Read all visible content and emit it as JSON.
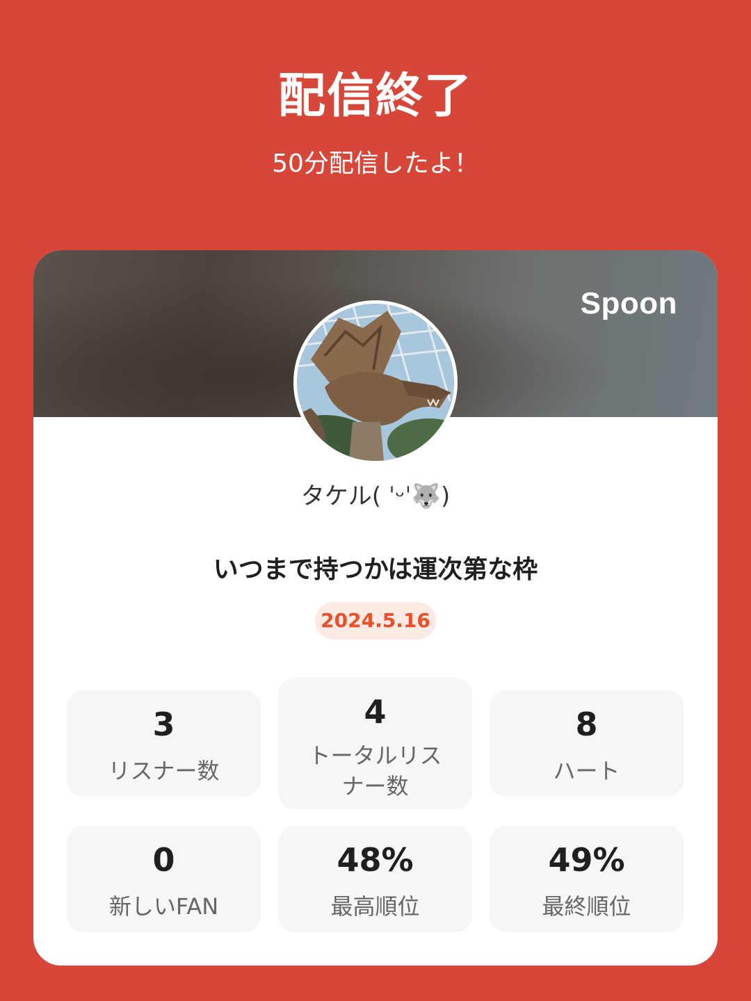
{
  "header": {
    "title": "配信終了",
    "subtitle": "50分配信したよ！"
  },
  "card": {
    "brand": "Spoon",
    "avatar_icon": "dragon-photo-avatar",
    "host_name": "タケル( ˈᵕˈ🐺)",
    "broadcast_title": "いつまで持つかは運次第な枠",
    "date": "2024.5.16"
  },
  "stats": [
    {
      "value": "3",
      "label": "リスナー数"
    },
    {
      "value": "4",
      "label": "トータルリスナー数"
    },
    {
      "value": "8",
      "label": "ハート"
    },
    {
      "value": "0",
      "label": "新しいFAN"
    },
    {
      "value": "48%",
      "label": "最高順位"
    },
    {
      "value": "49%",
      "label": "最終順位"
    }
  ],
  "colors": {
    "background": "#d6473a",
    "date_text": "#e8502a",
    "date_badge": "#fde9e3"
  }
}
